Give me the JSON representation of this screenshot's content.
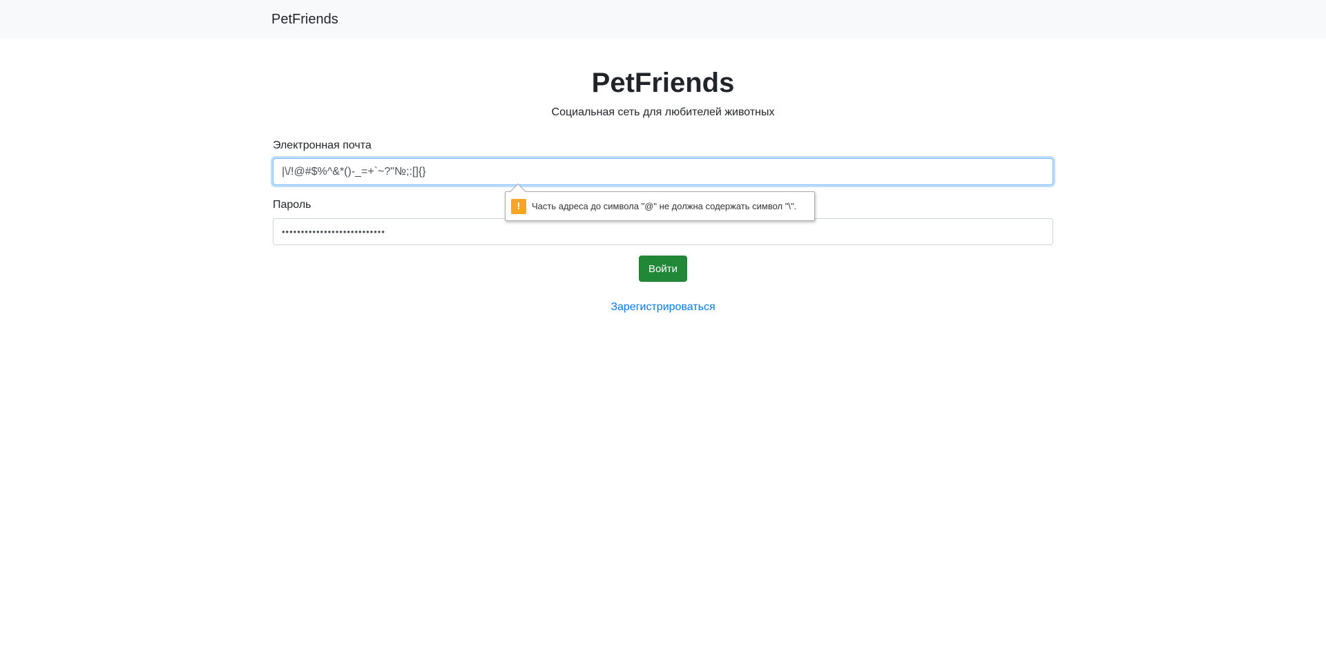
{
  "navbar": {
    "brand": "PetFriends"
  },
  "header": {
    "title": "PetFriends",
    "subtitle": "Социальная сеть для любителей животных"
  },
  "form": {
    "email_label": "Электронная почта",
    "email_value": "|\\/!@#$%^&*()-_=+`~?\"№;:[]{}",
    "password_label": "Пароль",
    "password_value": "•••••••••••••••••••••••••••",
    "submit_label": "Войти"
  },
  "validation_tooltip": {
    "icon": "warning-icon",
    "icon_glyph": "!",
    "message": "Часть адреса до символа \"@\" не должна содержать символ \"\\\"."
  },
  "register_link": {
    "label": "Зарегистрироваться"
  },
  "colors": {
    "navbar_bg": "#f8f9fa",
    "button_bg": "#218838",
    "link": "#007bff",
    "warning": "#f5a623",
    "focus_border": "#80bdff"
  }
}
